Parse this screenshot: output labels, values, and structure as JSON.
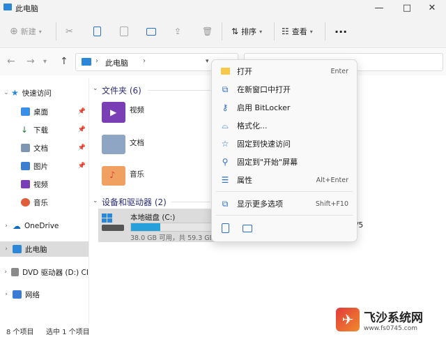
{
  "window": {
    "title": "此电脑",
    "min": "—",
    "max": "□",
    "close": "✕"
  },
  "toolbar": {
    "new_label": "新建",
    "sort_label": "排序",
    "view_label": "查看",
    "more_label": "···"
  },
  "address": {
    "crumbs": [
      "此电脑"
    ],
    "sep": "›"
  },
  "sidebar": {
    "items": [
      {
        "label": "快速访问"
      },
      {
        "label": "桌面"
      },
      {
        "label": "下载"
      },
      {
        "label": "文档"
      },
      {
        "label": "图片"
      },
      {
        "label": "视频"
      },
      {
        "label": "音乐"
      },
      {
        "label": "OneDrive"
      },
      {
        "label": "此电脑"
      },
      {
        "label": "DVD 驱动器 (D:) CI"
      },
      {
        "label": "网络"
      }
    ]
  },
  "content": {
    "folders_header": "文件夹 (6)",
    "folders": [
      {
        "label": "视频"
      },
      {
        "label": "文档"
      },
      {
        "label": "音乐"
      }
    ],
    "drives_header": "设备和驱动器 (2)",
    "drive": {
      "label": "本地磁盘 (C:)",
      "detail": "38.0 GB 可用，共 59.3 GB",
      "used_fraction": 0.36
    },
    "partial_text": "/5"
  },
  "status": {
    "count": "8 个项目",
    "selected": "选中 1 个项目"
  },
  "context_menu": {
    "items": [
      {
        "label": "打开",
        "shortcut": "Enter"
      },
      {
        "label": "在新窗口中打开",
        "shortcut": ""
      },
      {
        "label": "启用 BitLocker",
        "shortcut": ""
      },
      {
        "label": "格式化...",
        "shortcut": ""
      },
      {
        "label": "固定到快速访问",
        "shortcut": ""
      },
      {
        "label": "固定到\"开始\"屏幕",
        "shortcut": ""
      },
      {
        "label": "属性",
        "shortcut": "Alt+Enter"
      },
      {
        "label": "显示更多选项",
        "shortcut": "Shift+F10"
      }
    ]
  },
  "watermark": {
    "text": "飞沙系统网",
    "url": "www.fs0745.com"
  },
  "colors": {
    "accent": "#26a0da",
    "selection": "#dcdcdc",
    "folder_yellow": "#f7c948"
  }
}
